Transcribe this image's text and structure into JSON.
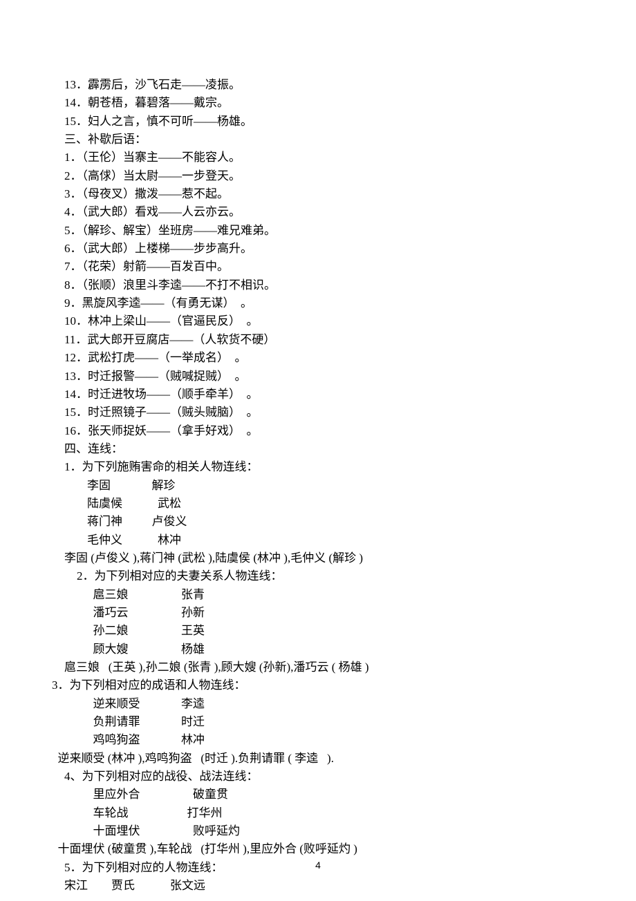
{
  "lines": [
    {
      "cls": "line indent1",
      "t": "13．霹雳后，沙飞石走——凌振。"
    },
    {
      "cls": "line indent1",
      "t": "14．朝苍梧，暮碧落——戴宗。"
    },
    {
      "cls": "line indent1",
      "t": "15．妇人之言，慎不可听——杨雄。"
    },
    {
      "cls": "line indent1",
      "t": "三、补歇后语："
    },
    {
      "cls": "line indent1",
      "t": "1．（王伦）当寨主——不能容人。"
    },
    {
      "cls": "line indent1",
      "t": "2．（高俅）当太尉——一步登天。"
    },
    {
      "cls": "line indent1",
      "t": "3．（母夜叉）撒泼——惹不起。"
    },
    {
      "cls": "line indent1",
      "t": "4．（武大郎）看戏——人云亦云。"
    },
    {
      "cls": "line indent1",
      "t": "5．（解珍、解宝）坐班房——难兄难弟。"
    },
    {
      "cls": "line indent1",
      "t": "6．（武大郎）上楼梯——步步高升。"
    },
    {
      "cls": "line indent1",
      "t": "7．（花荣）射箭——百发百中。"
    },
    {
      "cls": "line indent1",
      "t": "8．（张顺）浪里斗李逵——不打不相识。"
    },
    {
      "cls": "line indent1",
      "t": "9．黑旋风李逵——（有勇无谋）  。"
    },
    {
      "cls": "line indent1",
      "t": "10．林冲上梁山——（官逼民反）  。"
    },
    {
      "cls": "line indent1",
      "t": "11．武大郎开豆腐店——（人软货不硬）"
    },
    {
      "cls": "line indent1",
      "t": "12．武松打虎——（一举成名）  。"
    },
    {
      "cls": "line indent1",
      "t": "13．时迁报警——（贼喊捉贼）  。"
    },
    {
      "cls": "line indent1",
      "t": "14．时迁进牧场——（顺手牵羊）  。"
    },
    {
      "cls": "line indent1",
      "t": "15．时迁照镜子——（贼头贼脑）  。"
    },
    {
      "cls": "line indent1",
      "t": "16．张天师捉妖——（拿手好戏）  。"
    },
    {
      "cls": "line indent1",
      "t": "四、连线："
    },
    {
      "cls": "line indent1",
      "t": "1．为下列施贿害命的相关人物连线："
    },
    {
      "cls": "line",
      "t": "            李固              解珍"
    },
    {
      "cls": "line",
      "t": "            陆虞候            武松"
    },
    {
      "cls": "line",
      "t": "            蒋门神          卢俊义"
    },
    {
      "cls": "line",
      "t": "            毛仲义            林冲"
    },
    {
      "cls": "line indent1",
      "t": "李固 (卢俊义 ),蒋门神 (武松 ),陆虞侯 (林冲 ),毛仲义 (解珍 )"
    },
    {
      "cls": "line indent2",
      "t": "2．为下列相对应的夫妻关系人物连线："
    },
    {
      "cls": "line",
      "t": "              扈三娘                  张青"
    },
    {
      "cls": "line",
      "t": "              潘巧云                  孙新"
    },
    {
      "cls": "line",
      "t": "              孙二娘                  王英"
    },
    {
      "cls": "line",
      "t": "              顾大嫂                  杨雄"
    },
    {
      "cls": "line indent1",
      "t": "扈三娘   (王英 ),孙二娘 (张青 ),顾大嫂 (孙新),潘巧云 ( 杨雄 )"
    },
    {
      "cls": "line",
      "t": "3．为下列相对应的成语和人物连线："
    },
    {
      "cls": "line",
      "t": "              逆来顺受              李逵"
    },
    {
      "cls": "line",
      "t": "              负荆请罪              时迁"
    },
    {
      "cls": "line",
      "t": "              鸡鸣狗盗              林冲"
    },
    {
      "cls": "line",
      "t": "  逆来顺受 (林冲 ),鸡鸣狗盗   (时迁 ).负荆请罪 ( 李逵   )."
    },
    {
      "cls": "line indent1",
      "t": "4、为下列相对应的战役、战法连线："
    },
    {
      "cls": "line",
      "t": "              里应外合                  破童贯"
    },
    {
      "cls": "line",
      "t": "              车轮战                    打华州"
    },
    {
      "cls": "line",
      "t": "              十面埋伏                  败呼延灼"
    },
    {
      "cls": "line",
      "t": "  十面埋伏 (破童贯 ),车轮战   (打华州 ),里应外合 (败呼延灼 )"
    },
    {
      "cls": "line indent1",
      "t": "5．为下列相对应的人物连线："
    },
    {
      "cls": "line indent1",
      "t": "宋江        贾氏            张文远"
    }
  ],
  "page_number": "4"
}
